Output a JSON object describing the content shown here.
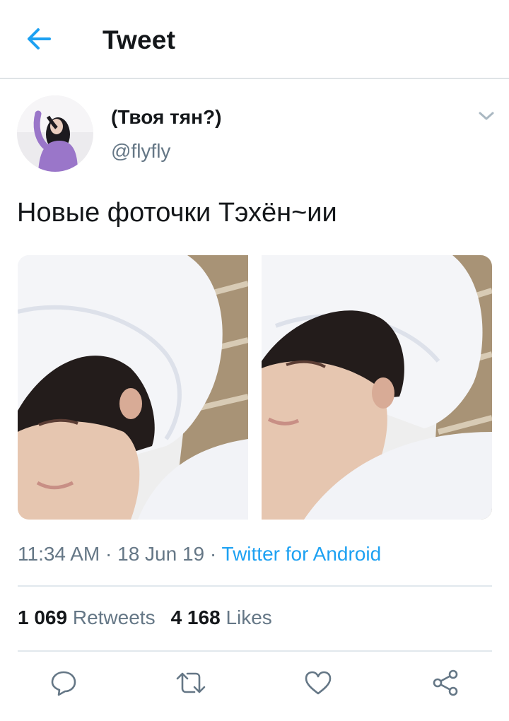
{
  "header": {
    "title": "Tweet",
    "back_icon": "arrow-left-icon"
  },
  "tweet": {
    "author": {
      "display_name": "(Твоя тян?)",
      "handle": "@flyfly"
    },
    "text": "Новые фоточки Тэхён~ии",
    "media_count": 2,
    "time": "11:34 AM",
    "separator": " · ",
    "date": "18 Jun 19",
    "source": "Twitter for Android",
    "retweets_count": "1 069",
    "retweets_label": "Retweets",
    "likes_count": "4 168",
    "likes_label": "Likes"
  },
  "actions": [
    {
      "icon": "reply-icon"
    },
    {
      "icon": "retweet-icon"
    },
    {
      "icon": "like-icon"
    },
    {
      "icon": "share-icon"
    }
  ],
  "colors": {
    "accent": "#1da1f2",
    "text_primary": "#14171a",
    "text_secondary": "#657786",
    "divider": "#e1e8ed"
  }
}
